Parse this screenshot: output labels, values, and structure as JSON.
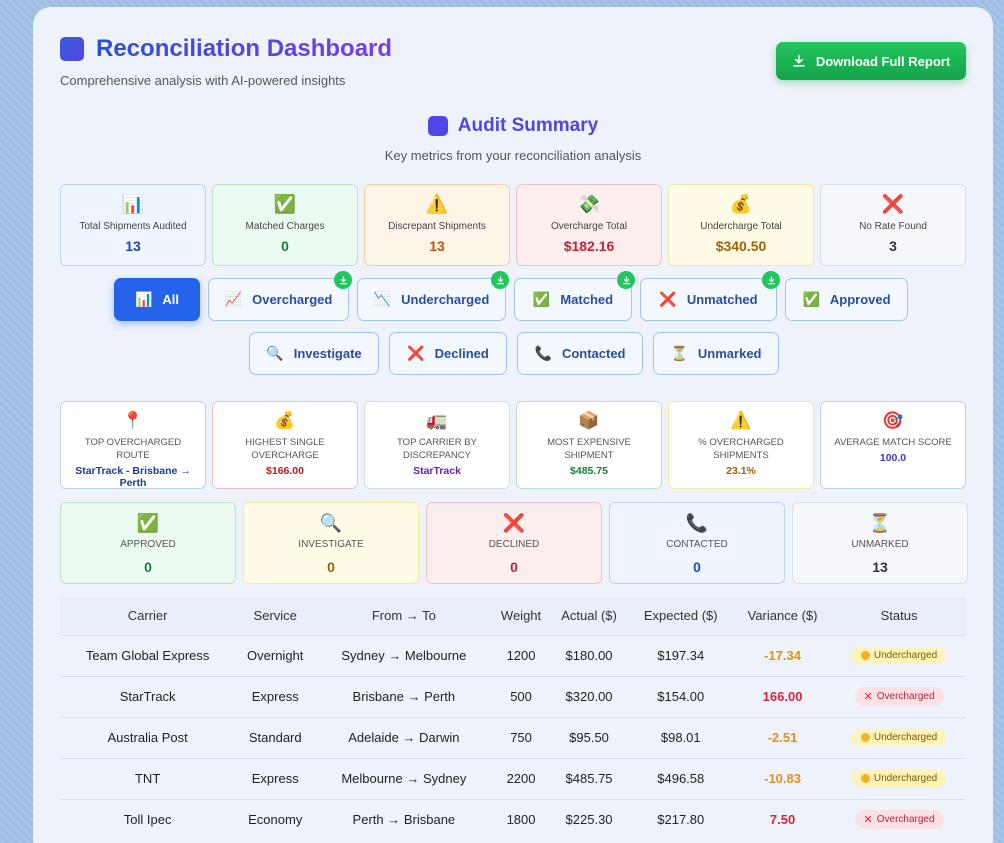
{
  "header": {
    "title": "Reconciliation Dashboard",
    "subtitle": "Comprehensive analysis with AI-powered insights",
    "download_label": "Download Full Report"
  },
  "audit": {
    "title": "Audit Summary",
    "subtitle": "Key metrics from your reconciliation analysis"
  },
  "stats": [
    {
      "emoji": "📊",
      "label": "Total Shipments Audited",
      "value": "13",
      "color": "#1e46b4",
      "bg": "#eef5ff",
      "border": "#b9d3f3"
    },
    {
      "emoji": "✅",
      "label": "Matched Charges",
      "value": "0",
      "color": "#177a3a",
      "bg": "#eafaf0",
      "border": "#b8e6c7"
    },
    {
      "emoji": "⚠️",
      "label": "Discrepant Shipments",
      "value": "13",
      "color": "#c2540a",
      "bg": "#fff4e8",
      "border": "#f5cfa3"
    },
    {
      "emoji": "💸",
      "label": "Overcharge Total",
      "value": "$182.16",
      "color": "#c2233a",
      "bg": "#fdeeee",
      "border": "#f3c0c6"
    },
    {
      "emoji": "💰",
      "label": "Undercharge Total",
      "value": "$340.50",
      "color": "#a16207",
      "bg": "#fffbe6",
      "border": "#f5e6a2"
    },
    {
      "emoji": "❌",
      "label": "No Rate Found",
      "value": "3",
      "color": "#333333",
      "bg": "#f5f7fa",
      "border": "#d6dde6"
    }
  ],
  "filters_row1": [
    {
      "emoji": "📊",
      "label": "All",
      "active": true,
      "download": false,
      "width": 86
    },
    {
      "emoji": "📈",
      "label": "Overcharged",
      "active": false,
      "download": true,
      "width": 141
    },
    {
      "emoji": "📉",
      "label": "Undercharged",
      "active": false,
      "download": true,
      "width": 149
    },
    {
      "emoji": "✅",
      "label": "Matched",
      "active": false,
      "download": true,
      "width": 118
    },
    {
      "emoji": "❌",
      "label": "Unmatched",
      "active": false,
      "download": true,
      "width": 137
    },
    {
      "emoji": "✅",
      "label": "Approved",
      "active": false,
      "download": false,
      "width": 123
    }
  ],
  "filters_row2": [
    {
      "emoji": "🔍",
      "label": "Investigate",
      "width": 130
    },
    {
      "emoji": "❌",
      "label": "Declined",
      "width": 118
    },
    {
      "emoji": "📞",
      "label": "Contacted",
      "width": 126
    },
    {
      "emoji": "⏳",
      "label": "Unmarked",
      "width": 126
    }
  ],
  "insights": [
    {
      "emoji": "📍",
      "label": "Top Overcharged Route",
      "value": "StarTrack - Brisbane → Perth",
      "color": "#1e3a8a",
      "border": "#b9d3f3"
    },
    {
      "emoji": "💰",
      "label": "Highest Single Overcharge",
      "value": "$166.00",
      "color": "#b91c1c",
      "border": "#f3c0c6"
    },
    {
      "emoji": "🚛",
      "label": "Top Carrier by Discrepancy",
      "value": "StarTrack",
      "color": "#6b21a8",
      "border": "#d6dde6"
    },
    {
      "emoji": "📦",
      "label": "Most Expensive Shipment",
      "value": "$485.75",
      "color": "#15803d",
      "border": "#b8e6c7"
    },
    {
      "emoji": "⚠️",
      "label": "% Overcharged Shipments",
      "value": "23.1%",
      "color": "#a16207",
      "border": "#f5e6a2"
    },
    {
      "emoji": "🎯",
      "label": "Average Match Score",
      "value": "100.0",
      "color": "#4338ca",
      "border": "#b9d3f3"
    }
  ],
  "status_cards": [
    {
      "emoji": "✅",
      "label": "Approved",
      "value": "0",
      "color": "#177a3a",
      "bg": "#eafaf0",
      "border": "#b8e6c7"
    },
    {
      "emoji": "🔍",
      "label": "Investigate",
      "value": "0",
      "color": "#a16207",
      "bg": "#fffbe6",
      "border": "#f5e6a2"
    },
    {
      "emoji": "❌",
      "label": "Declined",
      "value": "0",
      "color": "#c2233a",
      "bg": "#fdeeee",
      "border": "#f3c0c6"
    },
    {
      "emoji": "📞",
      "label": "Contacted",
      "value": "0",
      "color": "#1e46b4",
      "bg": "#eef5ff",
      "border": "#b9d3f3"
    },
    {
      "emoji": "⏳",
      "label": "Unmarked",
      "value": "13",
      "color": "#333333",
      "bg": "#f5f7fa",
      "border": "#d6dde6"
    }
  ],
  "table": {
    "headers": [
      "Carrier",
      "Service",
      "From → To",
      "Weight",
      "Actual ($)",
      "Expected ($)",
      "Variance ($)",
      "Status"
    ],
    "rows": [
      {
        "carrier": "Team Global Express",
        "service": "Overnight",
        "route": "Sydney → Melbourne",
        "weight": "1200",
        "actual": "$180.00",
        "expected": "$197.34",
        "variance": "-17.34",
        "status": "Undercharged"
      },
      {
        "carrier": "StarTrack",
        "service": "Express",
        "route": "Brisbane → Perth",
        "weight": "500",
        "actual": "$320.00",
        "expected": "$154.00",
        "variance": "166.00",
        "status": "Overcharged"
      },
      {
        "carrier": "Australia Post",
        "service": "Standard",
        "route": "Adelaide → Darwin",
        "weight": "750",
        "actual": "$95.50",
        "expected": "$98.01",
        "variance": "-2.51",
        "status": "Undercharged"
      },
      {
        "carrier": "TNT",
        "service": "Express",
        "route": "Melbourne → Sydney",
        "weight": "2200",
        "actual": "$485.75",
        "expected": "$496.58",
        "variance": "-10.83",
        "status": "Undercharged"
      },
      {
        "carrier": "Toll Ipec",
        "service": "Economy",
        "route": "Perth → Brisbane",
        "weight": "1800",
        "actual": "$225.30",
        "expected": "$217.80",
        "variance": "7.50",
        "status": "Overcharged"
      }
    ]
  }
}
